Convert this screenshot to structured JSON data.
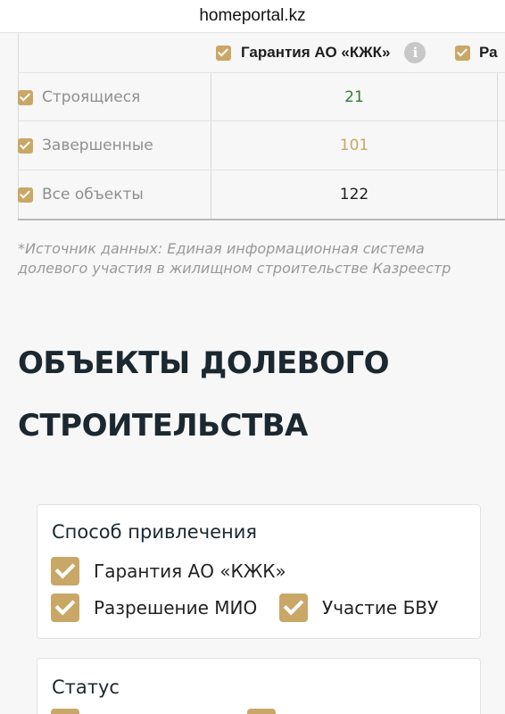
{
  "browser": {
    "url": "homeportal.kz"
  },
  "table": {
    "columns": [
      {
        "label": "Гарантия АО «КЖК»"
      },
      {
        "label": "Ра"
      }
    ],
    "rows": [
      {
        "label": "Строящиеся",
        "value": "21",
        "color": "#2e7d32"
      },
      {
        "label": "Завершенные",
        "value": "101",
        "color": "#c9a767"
      },
      {
        "label": "Все объекты",
        "value": "122",
        "color": "#1e1e1e"
      }
    ]
  },
  "source_note": "*Источник данных: Единая информационная система долевого участия в жилищном строительстве Казреестр",
  "section": {
    "title_line1": "ОБЪЕКТЫ ДОЛЕВОГО",
    "title_line2": "СТРОИТЕЛЬСТВА"
  },
  "filters": {
    "method": {
      "title": "Способ привлечения",
      "options": [
        {
          "label": "Гарантия АО «КЖК»",
          "checked": true
        },
        {
          "label": "Разрешение МИО",
          "checked": true
        },
        {
          "label": "Участие БВУ",
          "checked": true
        }
      ]
    },
    "status": {
      "title": "Статус"
    }
  },
  "colors": {
    "accent": "#c9a767",
    "heading": "#1b2830",
    "positive": "#2e7d32"
  }
}
